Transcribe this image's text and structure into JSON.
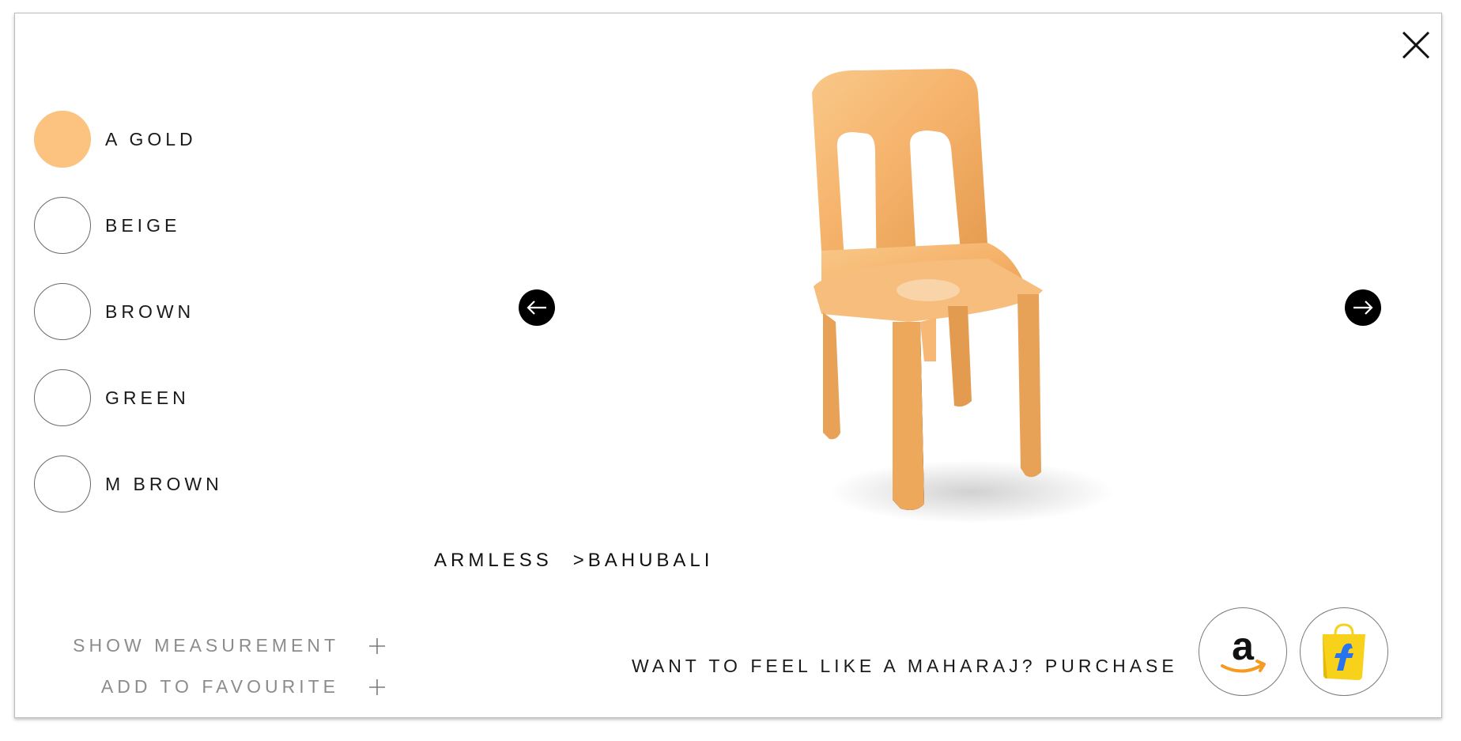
{
  "colors": {
    "accent_gold": "#fbc37f",
    "chair_body": "#f5b26a",
    "nav_arrow_bg": "#000000",
    "muted_text": "#8c8c8c"
  },
  "swatches": [
    {
      "label": "A GOLD",
      "selected": true,
      "color": "#fbc37f"
    },
    {
      "label": "BEIGE",
      "selected": false
    },
    {
      "label": "BROWN",
      "selected": false
    },
    {
      "label": "GREEN",
      "selected": false
    },
    {
      "label": "M BROWN",
      "selected": false
    }
  ],
  "breadcrumb": {
    "category": "ARMLESS",
    "separator": ">",
    "product": "BAHUBALI"
  },
  "actions": {
    "show_measurement": "SHOW MEASUREMENT",
    "add_to_favourite": "ADD TO FAVOURITE"
  },
  "purchase": {
    "prompt": "WANT TO FEEL LIKE A MAHARAJ? PURCHASE",
    "stores": [
      "amazon-icon",
      "flipkart-icon"
    ]
  },
  "icons": {
    "close": "close-icon",
    "prev": "arrow-left-icon",
    "next": "arrow-right-icon",
    "plus": "plus-icon"
  }
}
